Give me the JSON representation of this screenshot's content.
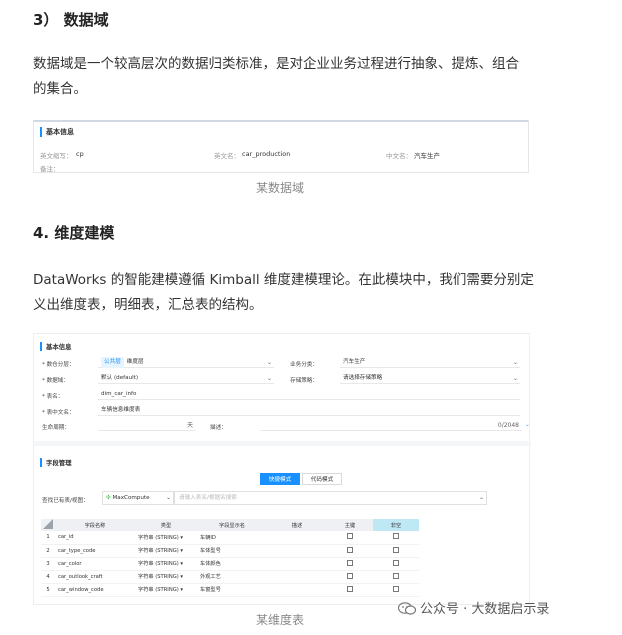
{
  "heading3": "3）  数据域",
  "para1_line1": "数据域是一个较高层次的数据归类标准，是对企业业务过程进行抽象、提炼、组合",
  "para1_line2": "的集合。",
  "card1": {
    "title": "基本信息",
    "en_abbr_label": "英文缩写：",
    "en_abbr_value": "cp",
    "en_name_label": "英文名：",
    "en_name_value": "car_production",
    "cn_name_label": "中文名：",
    "cn_name_value": "汽车生产",
    "remark_label": "备注："
  },
  "caption1": "某数据域",
  "heading4": "4.  维度建模",
  "para2_line1": "DataWorks 的智能建模遵循 Kimball 维度建模理论。在此模块中，我们需要分别定",
  "para2_line2": "义出维度表，明细表，汇总表的结构。",
  "form": {
    "section1_title": "基本信息",
    "data_category_label": "* 数仓分层：",
    "data_category_tag": "公共层",
    "data_category_value": "维度层",
    "business_label": "业务分类：",
    "business_value": "汽车生产",
    "domain_label": "* 数据域：",
    "domain_value": "默认 (default)",
    "storage_label": "存储策略：",
    "storage_value": "请选择存储策略",
    "table_name_label": "* 表名：",
    "table_name_value": "dim_car_info",
    "table_cn_label": "* 表中文名：",
    "table_cn_value": "车辆信息维度表",
    "lifecycle_label": "生命周期：",
    "lifecycle_unit": "天",
    "desc_label": "描述：",
    "desc_counter": "0/2048",
    "section2_title": "字段管理",
    "quick_mode": "快捷模式",
    "code_mode": "代码模式",
    "lookup_label": "查找已有表/视图：",
    "engine": "MaxCompute",
    "lookup_placeholder": "请输入表名/根据名搜索"
  },
  "fields_table": {
    "headers": [
      "",
      "字段名称",
      "类型",
      "字段显示名",
      "描述",
      "主键",
      "非空"
    ],
    "rows": [
      {
        "num": "1",
        "name": "car_id",
        "type": "字符串 (STRING)",
        "display": "车辆ID"
      },
      {
        "num": "2",
        "name": "car_type_code",
        "type": "字符串 (STRING)",
        "display": "车体型号"
      },
      {
        "num": "3",
        "name": "car_color",
        "type": "字符串 (STRING)",
        "display": "车体颜色"
      },
      {
        "num": "4",
        "name": "car_outlook_craft",
        "type": "字符串 (STRING)",
        "display": "外观工艺"
      },
      {
        "num": "5",
        "name": "car_window_code",
        "type": "字符串 (STRING)",
        "display": "车窗型号"
      }
    ]
  },
  "caption2": "某维度表",
  "watermark": "公众号 · 大数据启示录",
  "accent_color": "#1890ff"
}
